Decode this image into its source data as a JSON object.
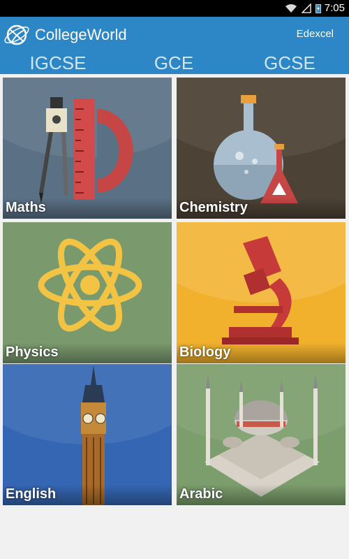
{
  "status_bar": {
    "time": "7:05",
    "icons": [
      "wifi-icon",
      "signal-icon",
      "battery-icon"
    ]
  },
  "action_bar": {
    "title": "CollegeWorld",
    "board": "Edexcel",
    "logo_icon": "globe-logo-icon"
  },
  "tabs": [
    {
      "label": "IGCSE"
    },
    {
      "label": "GCE"
    },
    {
      "label": "GCSE"
    }
  ],
  "subjects": [
    {
      "label": "Maths",
      "icon": "compass-ruler-protractor-icon",
      "bg": "#5a7185"
    },
    {
      "label": "Chemistry",
      "icon": "flask-icon",
      "bg": "#4d4236"
    },
    {
      "label": "Physics",
      "icon": "atom-icon",
      "bg": "#7a9a6e"
    },
    {
      "label": "Biology",
      "icon": "microscope-icon",
      "bg": "#f2b12c"
    },
    {
      "label": "English",
      "icon": "big-ben-icon",
      "bg": "#3566b3"
    },
    {
      "label": "Arabic",
      "icon": "mosque-icon",
      "bg": "#7b9e6c"
    }
  ]
}
